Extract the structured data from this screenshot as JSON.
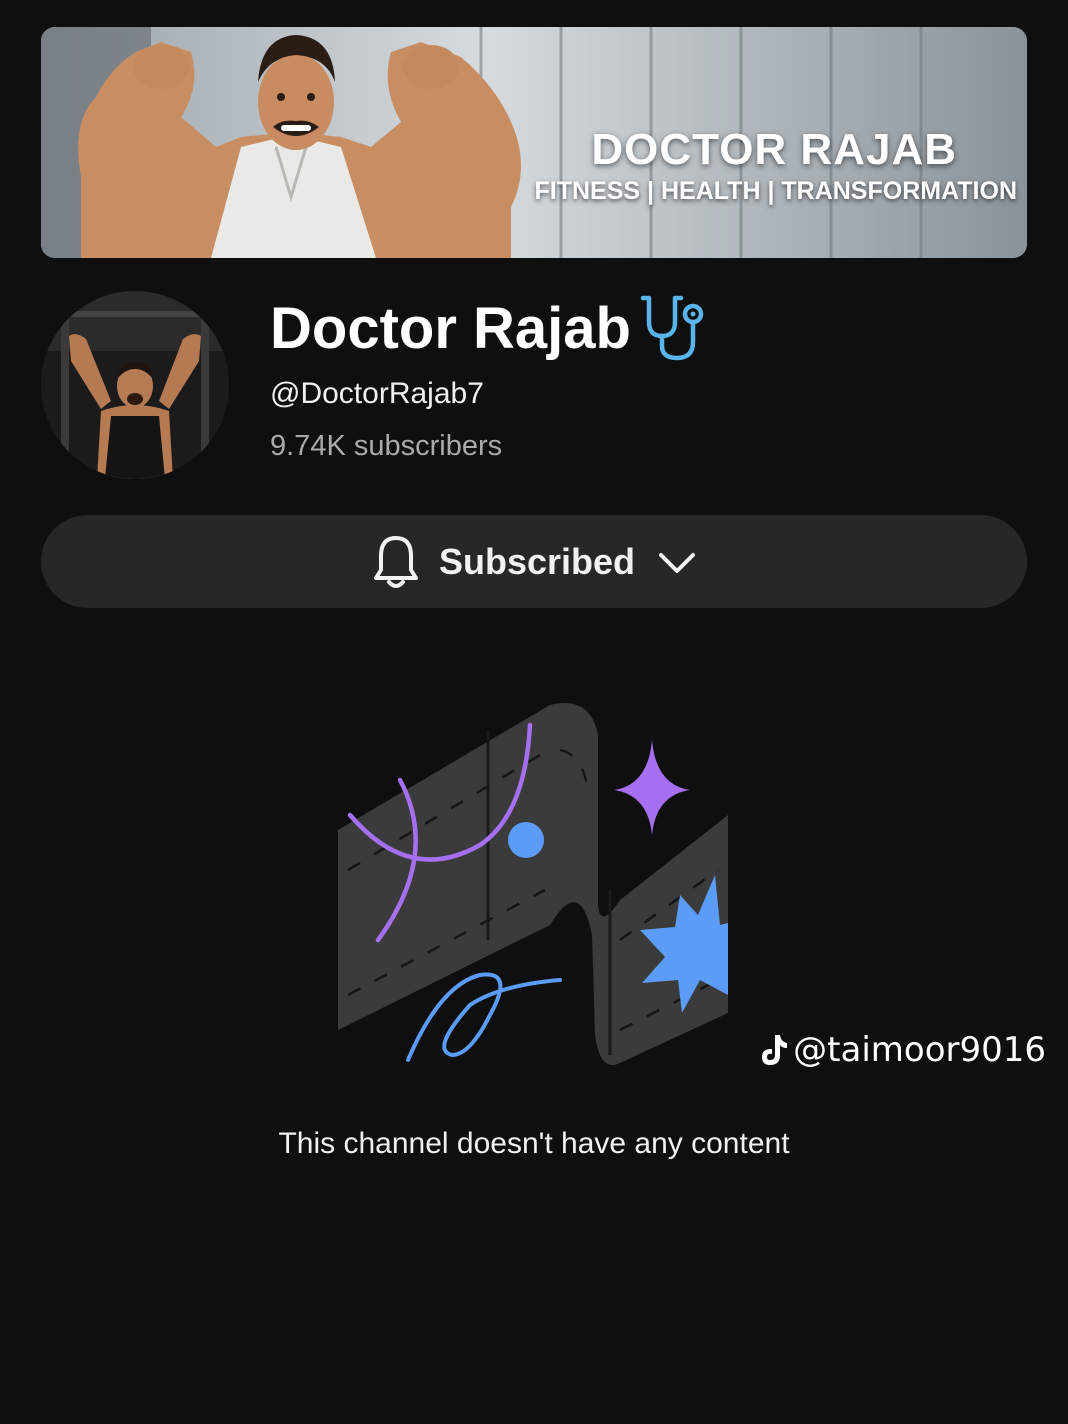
{
  "banner": {
    "title": "DOCTOR RAJAB",
    "tagline": "FITNESS | HEALTH | TRANSFORMATION"
  },
  "channel": {
    "name": "Doctor Rajab",
    "handle": "@DoctorRajab7",
    "subscribers": "9.74K subscribers"
  },
  "subscribe_button": {
    "label": "Subscribed"
  },
  "empty_state": {
    "message": "This channel doesn't have any content"
  },
  "watermark": {
    "text": "@taimoor9016"
  },
  "colors": {
    "background": "#0f0f0f",
    "button_bg": "#272727",
    "purple": "#a56ff0",
    "blue": "#5a9cf8",
    "stethoscope": "#5ab4ec"
  },
  "icons": [
    "stethoscope-icon",
    "bell-icon",
    "chevron-down-icon",
    "tiktok-icon"
  ]
}
